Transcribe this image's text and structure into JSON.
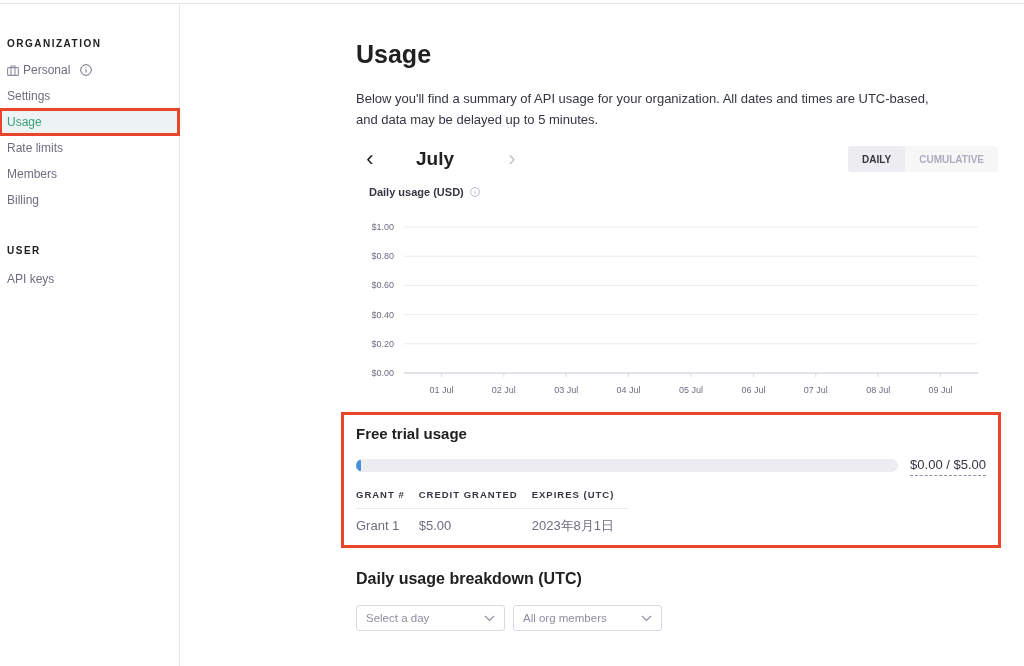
{
  "sidebar": {
    "sections": [
      {
        "heading": "ORGANIZATION",
        "items": [
          {
            "label": "Personal",
            "kind": "org",
            "selected": false,
            "highlighted": false
          },
          {
            "label": "Settings",
            "kind": "link",
            "selected": false,
            "highlighted": false
          },
          {
            "label": "Usage",
            "kind": "link",
            "selected": true,
            "highlighted": true
          },
          {
            "label": "Rate limits",
            "kind": "link",
            "selected": false,
            "highlighted": false
          },
          {
            "label": "Members",
            "kind": "link",
            "selected": false,
            "highlighted": false
          },
          {
            "label": "Billing",
            "kind": "link",
            "selected": false,
            "highlighted": false
          }
        ]
      },
      {
        "heading": "USER",
        "items": [
          {
            "label": "API keys",
            "kind": "link",
            "selected": false,
            "highlighted": false
          }
        ]
      }
    ]
  },
  "page": {
    "title": "Usage",
    "description": "Below you'll find a summary of API usage for your organization. All dates and times are UTC-based, and data may be delayed up to 5 minutes."
  },
  "month_nav": {
    "prev": "‹",
    "month": "July",
    "next": "›",
    "next_disabled": true
  },
  "view_toggle": [
    {
      "label": "DAILY",
      "selected": true
    },
    {
      "label": "CUMULATIVE",
      "selected": false
    }
  ],
  "chart": {
    "title": "Daily usage (USD)",
    "chart_data": {
      "type": "bar",
      "grid": true,
      "categories": [
        "01 Jul",
        "02 Jul",
        "03 Jul",
        "04 Jul",
        "05 Jul",
        "06 Jul",
        "07 Jul",
        "08 Jul",
        "09 Jul"
      ],
      "ylim": [
        0,
        1
      ],
      "yticks": [
        {
          "value": 0,
          "label": "$0.00"
        },
        {
          "value": 0.2,
          "label": "$0.20"
        },
        {
          "value": 0.4,
          "label": "$0.40"
        },
        {
          "value": 0.6,
          "label": "$0.60"
        },
        {
          "value": 0.8,
          "label": "$0.80"
        },
        {
          "value": 1,
          "label": "$1.00"
        }
      ]
    }
  },
  "free_trial": {
    "title": "Free trial usage",
    "highlighted": true,
    "level": 0.01,
    "reading": "$0.00 / $5.00",
    "columns": [
      "GRANT #",
      "CREDIT GRANTED",
      "EXPIRES (UTC)"
    ],
    "rows": [
      [
        "Grant 1",
        "$5.00",
        "2023年8月1日"
      ]
    ]
  },
  "breakdown": {
    "title": "Daily usage breakdown (UTC)",
    "filters": [
      {
        "placeholder": "Select a day"
      },
      {
        "value": "All org members"
      }
    ]
  }
}
